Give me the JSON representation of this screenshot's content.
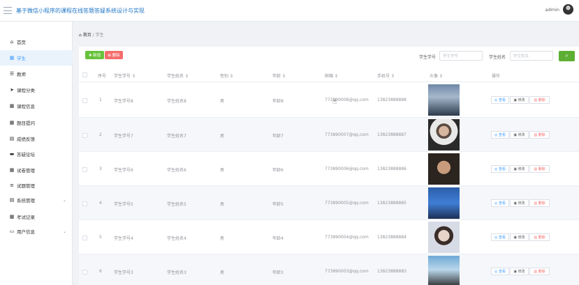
{
  "header": {
    "title": "基于微信小程序的课程在线答题答疑系统设计与实现",
    "user": "admin"
  },
  "sidebar": {
    "items": [
      {
        "label": "首页",
        "icon": "home-icon",
        "glyph": "⌂"
      },
      {
        "label": "学生",
        "icon": "grid-icon",
        "glyph": "▦"
      },
      {
        "label": "教师",
        "icon": "sliders-icon",
        "glyph": "☰"
      },
      {
        "label": "课程分类",
        "icon": "send-icon",
        "glyph": "➤"
      },
      {
        "label": "课程信息",
        "icon": "grid-icon",
        "glyph": "▦"
      },
      {
        "label": "题目提问",
        "icon": "grid-icon",
        "glyph": "▦"
      },
      {
        "label": "成绩反馈",
        "icon": "clipboard-icon",
        "glyph": "▤"
      },
      {
        "label": "答疑论坛",
        "icon": "monitor-icon",
        "glyph": "▬"
      },
      {
        "label": "试卷管理",
        "icon": "table-icon",
        "glyph": "▦"
      },
      {
        "label": "试题管理",
        "icon": "list-icon",
        "glyph": "≡"
      },
      {
        "label": "系统管理",
        "icon": "clipboard-icon",
        "glyph": "▤"
      },
      {
        "label": "考试记录",
        "icon": "grid-icon",
        "glyph": "▦"
      },
      {
        "label": "用户信息",
        "icon": "card-icon",
        "glyph": "▭"
      }
    ]
  },
  "breadcrumb": {
    "home": "首页",
    "sep": "/",
    "current": "学生"
  },
  "toolbar": {
    "add_label": "✚ 新增",
    "delete_label": "⊠ 删除"
  },
  "search": {
    "label1": "学生学号",
    "placeholder1": "学生学号",
    "label2": "学生姓名",
    "placeholder2": "学生姓名",
    "button_glyph": "⌕"
  },
  "table": {
    "headers": [
      "序号",
      "学生学号 ⇕",
      "学生姓名 ⇕",
      "性别 ⇕",
      "年龄 ⇕",
      "邮箱 ⇕",
      "手机号 ⇕",
      "头像 ⇕",
      "操作"
    ],
    "rows": [
      {
        "index": "1",
        "student_id": "学生学号8",
        "name": "学生姓名8",
        "gender": "男",
        "age": "年龄8",
        "email": "773890008@qq.com",
        "phone": "13823888888"
      },
      {
        "index": "2",
        "student_id": "学生学号7",
        "name": "学生姓名7",
        "gender": "男",
        "age": "年龄7",
        "email": "773890007@qq.com",
        "phone": "13823888887"
      },
      {
        "index": "3",
        "student_id": "学生学号6",
        "name": "学生姓名6",
        "gender": "男",
        "age": "年龄6",
        "email": "773890006@qq.com",
        "phone": "13823888886"
      },
      {
        "index": "4",
        "student_id": "学生学号5",
        "name": "学生姓名5",
        "gender": "男",
        "age": "年龄5",
        "email": "773890005@qq.com",
        "phone": "13823888885"
      },
      {
        "index": "5",
        "student_id": "学生学号4",
        "name": "学生姓名4",
        "gender": "男",
        "age": "年龄4",
        "email": "773890004@qq.com",
        "phone": "13823888884"
      },
      {
        "index": "6",
        "student_id": "学生学号3",
        "name": "学生姓名3",
        "gender": "男",
        "age": "年龄3",
        "email": "773890003@qq.com",
        "phone": "13823888883"
      }
    ],
    "actions": {
      "view": "◎ 查看",
      "edit": "▣ 修改",
      "delete": "▥ 删除"
    }
  },
  "colors": {
    "primary": "#409eff",
    "success": "#67c23a",
    "danger": "#f56c6c",
    "title": "#1f76c6"
  }
}
